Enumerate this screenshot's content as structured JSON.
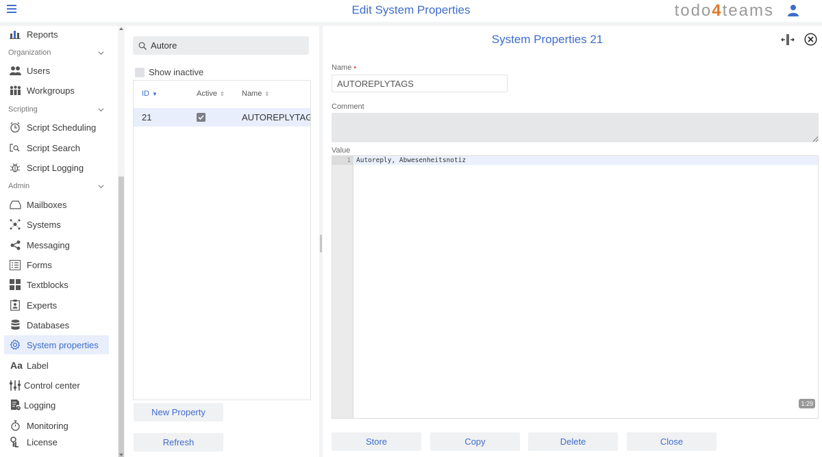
{
  "header": {
    "title": "Edit System Properties",
    "brand_prefix": "todo",
    "brand_number": "4",
    "brand_suffix": "teams",
    "accent_color": "#3d6dcc",
    "brand_color": "#e0782e"
  },
  "sidebar": {
    "items": [
      {
        "label": "Reports",
        "icon": "bar-chart-icon"
      },
      {
        "label": "Users",
        "icon": "users-icon"
      },
      {
        "label": "Workgroups",
        "icon": "workgroups-icon"
      },
      {
        "label": "Script Scheduling",
        "icon": "clock-icon"
      },
      {
        "label": "Script Search",
        "icon": "search-code-icon"
      },
      {
        "label": "Script Logging",
        "icon": "bug-icon"
      },
      {
        "label": "Mailboxes",
        "icon": "inbox-icon"
      },
      {
        "label": "Systems",
        "icon": "network-icon"
      },
      {
        "label": "Messaging",
        "icon": "share-icon"
      },
      {
        "label": "Forms",
        "icon": "list-icon"
      },
      {
        "label": "Textblocks",
        "icon": "grid-icon"
      },
      {
        "label": "Experts",
        "icon": "badge-icon"
      },
      {
        "label": "Databases",
        "icon": "database-icon"
      },
      {
        "label": "System properties",
        "icon": "gear-icon",
        "active": true
      },
      {
        "label": "Label",
        "icon": "text-icon"
      },
      {
        "label": "Control center",
        "icon": "sliders-icon"
      },
      {
        "label": "Logging",
        "icon": "log-icon"
      },
      {
        "label": "Monitoring",
        "icon": "stopwatch-icon"
      },
      {
        "label": "License",
        "icon": "key-icon"
      }
    ],
    "sections": [
      {
        "label": "Organization",
        "icon": "chevron-down-icon"
      },
      {
        "label": "Scripting",
        "icon": "chevron-down-icon"
      },
      {
        "label": "Admin",
        "icon": "chevron-down-icon"
      }
    ]
  },
  "list": {
    "search_value": "Autore",
    "show_inactive_label": "Show inactive",
    "columns": [
      "ID",
      "Active",
      "Name"
    ],
    "rows": [
      {
        "id": "21",
        "active": true,
        "name": "AUTOREPLYTAGS"
      }
    ],
    "new_button": "New Property",
    "refresh_button": "Refresh"
  },
  "detail": {
    "title": "System Properties 21",
    "name_label": "Name",
    "required_mark": "•",
    "name_value": "AUTOREPLYTAGS",
    "comment_label": "Comment",
    "comment_value": "",
    "value_label": "Value",
    "line_number": "1",
    "code_value": "Autoreply, Abwesenheitsnotiz",
    "cursor_position": "1:29",
    "buttons": {
      "store": "Store",
      "copy": "Copy",
      "delete": "Delete",
      "close": "Close"
    }
  }
}
